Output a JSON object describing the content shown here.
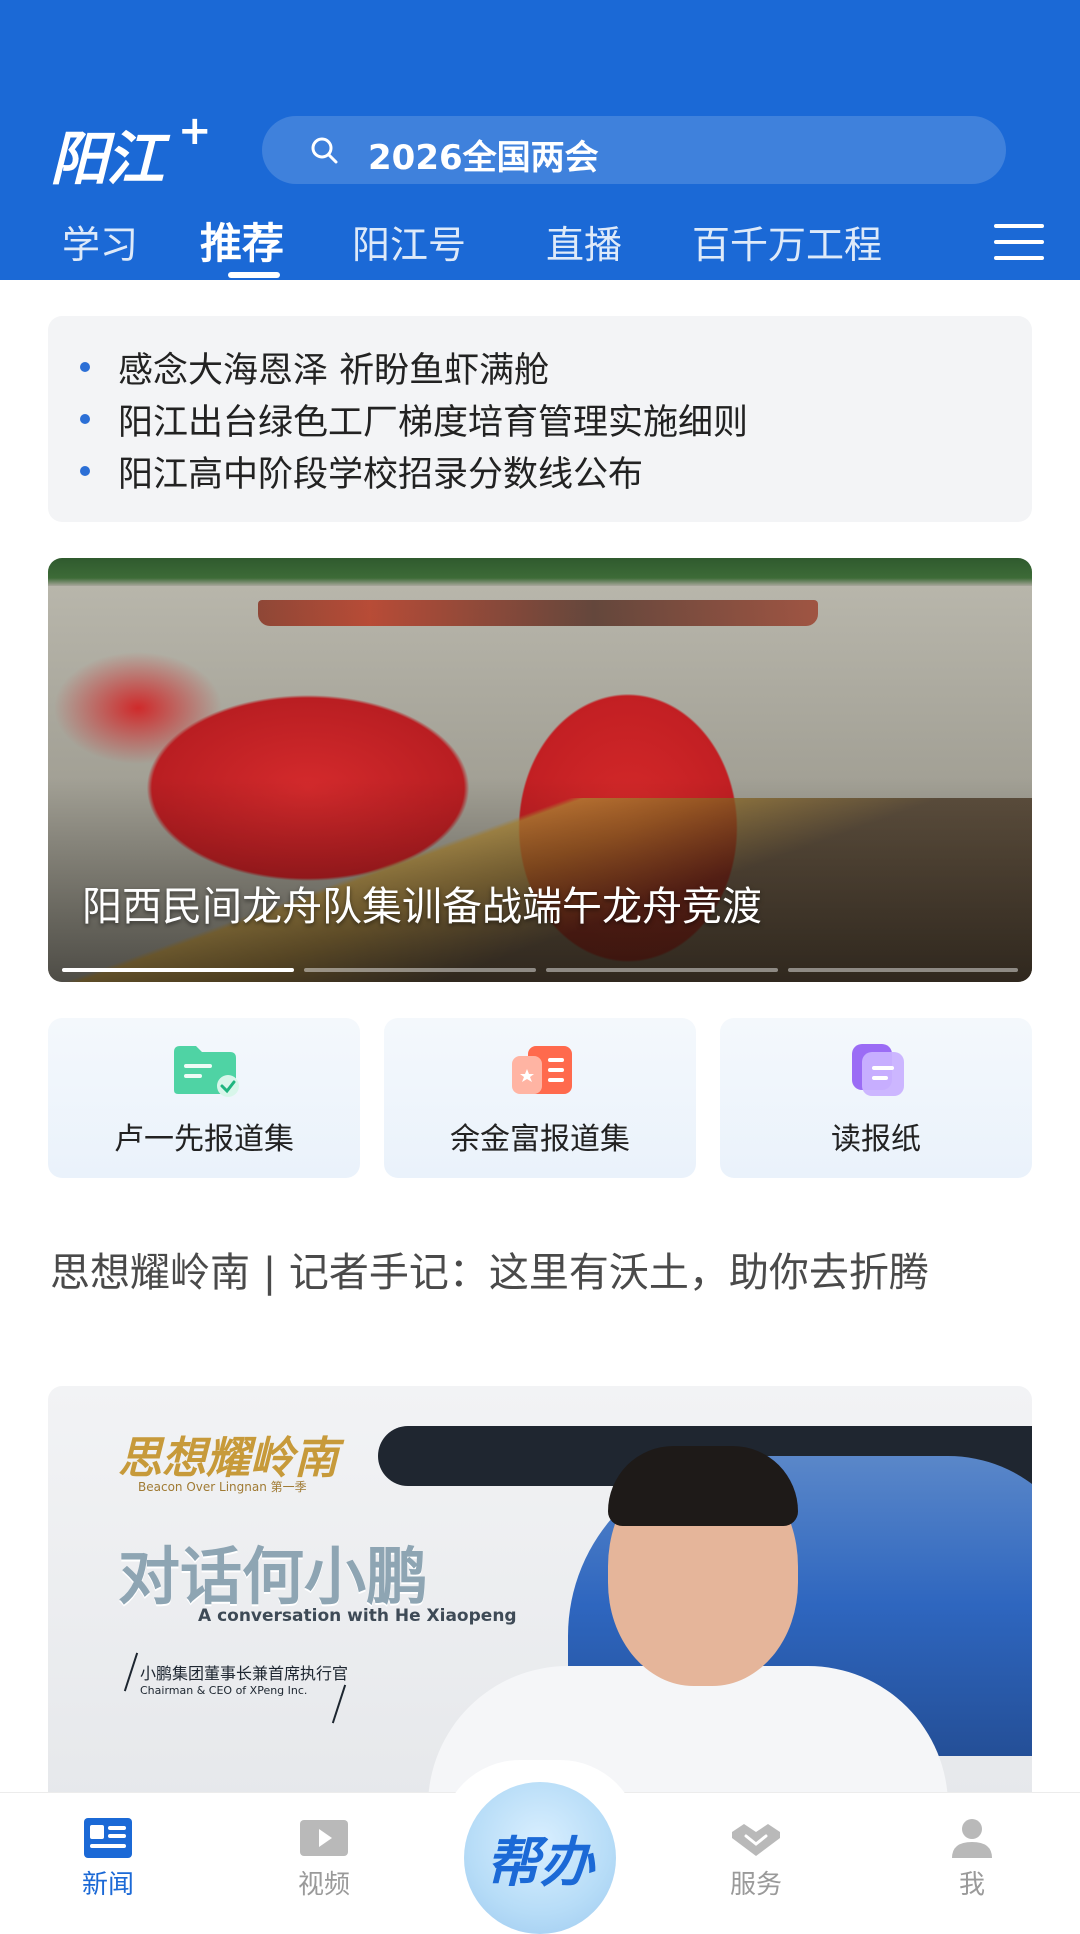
{
  "header": {
    "logo": "阳江",
    "logo_plus": "+",
    "search_text": "2026全国两会",
    "tabs": [
      {
        "label": "学习"
      },
      {
        "label": "推荐"
      },
      {
        "label": "阳江号"
      },
      {
        "label": "直播"
      },
      {
        "label": "百千万工程"
      }
    ],
    "active_tab": "推荐",
    "icons": {
      "search": "search-icon",
      "menu": "menu-icon"
    }
  },
  "headlines": [
    "感念大海恩泽 祈盼鱼虾满舱",
    "阳江出台绿色工厂梯度培育管理实施细则",
    "阳江高中阶段学校招录分数线公布"
  ],
  "banner": {
    "caption": "阳西民间龙舟队集训备战端午龙舟竞渡",
    "slides_total": 4,
    "active_slide": 1
  },
  "quick_cards": [
    {
      "label": "卢一先报道集",
      "icon": "folder-check-icon"
    },
    {
      "label": "余金富报道集",
      "icon": "newspaper-star-icon"
    },
    {
      "label": "读报纸",
      "icon": "document-stack-icon"
    }
  ],
  "article": {
    "title": "思想耀岭南 | 记者手记：这里有沃土，助你去折腾",
    "image": {
      "brand": "思想耀岭南",
      "brand_sub": "Beacon Over Lingnan 第一季",
      "headline": "对话何小鹏",
      "headline_en": "A conversation with He Xiaopeng",
      "role": "小鹏集团董事长兼首席执行官",
      "role_en": "Chairman & CEO of XPeng Inc."
    }
  },
  "bottom_nav": [
    {
      "label": "新闻",
      "icon": "news-icon",
      "active": true
    },
    {
      "label": "视频",
      "icon": "video-icon",
      "active": false
    },
    {
      "label": "帮办",
      "icon": "help-button",
      "active": false
    },
    {
      "label": "服务",
      "icon": "handshake-icon",
      "active": false
    },
    {
      "label": "我",
      "icon": "user-icon",
      "active": false
    }
  ],
  "colors": {
    "brand_blue": "#1b69d6",
    "headline_bullet": "#2b6fd6",
    "nav_inactive": "#9a9a9a"
  }
}
